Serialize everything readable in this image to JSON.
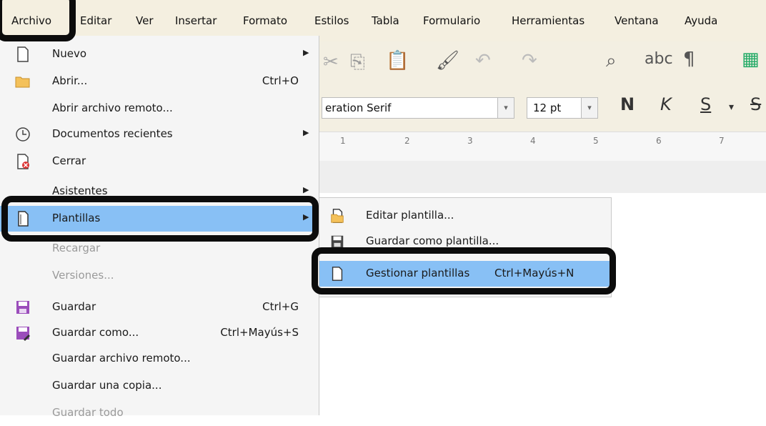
{
  "menubar": {
    "items": [
      {
        "label": "Archivo"
      },
      {
        "label": "Editar"
      },
      {
        "label": "Ver"
      },
      {
        "label": "Insertar"
      },
      {
        "label": "Formato"
      },
      {
        "label": "Estilos"
      },
      {
        "label": "Tabla"
      },
      {
        "label": "Formulario"
      },
      {
        "label": "Herramientas"
      },
      {
        "label": "Ventana"
      },
      {
        "label": "Ayuda"
      }
    ]
  },
  "toolbar": {
    "font_name": "eration Serif",
    "font_size": "12 pt",
    "bold": "N",
    "italic": "K",
    "underline": "S",
    "strike": "S",
    "abc_label": "abc",
    "pilcrow": "¶",
    "ruler_numbers": [
      "1",
      "2",
      "3",
      "4",
      "5",
      "6",
      "7"
    ]
  },
  "file_menu": {
    "items": [
      {
        "label": "Nuevo",
        "icon": "new-document-icon",
        "submenu": true
      },
      {
        "label": "Abrir...",
        "shortcut": "Ctrl+O",
        "icon": "folder-open-icon"
      },
      {
        "label": "Abrir archivo remoto..."
      },
      {
        "label": "Documentos recientes",
        "icon": "clock-icon",
        "submenu": true
      },
      {
        "label": "Cerrar",
        "icon": "close-document-icon"
      },
      {
        "label": "Asistentes",
        "submenu": true
      },
      {
        "label": "Plantillas",
        "icon": "templates-icon",
        "submenu": true,
        "highlighted": true
      },
      {
        "label": "Recargar",
        "disabled": true
      },
      {
        "label": "Versiones...",
        "disabled": true
      },
      {
        "label": "Guardar",
        "shortcut": "Ctrl+G",
        "icon": "save-icon"
      },
      {
        "label": "Guardar como...",
        "shortcut": "Ctrl+Mayús+S",
        "icon": "save-as-icon"
      },
      {
        "label": "Guardar archivo remoto..."
      },
      {
        "label": "Guardar una copia..."
      },
      {
        "label": "Guardar todo",
        "disabled": true
      }
    ]
  },
  "templates_submenu": {
    "items": [
      {
        "label": "Editar plantilla...",
        "icon": "edit-template-icon"
      },
      {
        "label": "Guardar como plantilla...",
        "icon": "save-template-icon"
      },
      {
        "label": "Gestionar plantillas",
        "shortcut": "Ctrl+Mayús+N",
        "icon": "manage-templates-icon",
        "highlighted": true
      }
    ]
  },
  "colors": {
    "highlight": "#88c0f5",
    "annotation_border": "#0c0c0c",
    "menubar_bg": "#f4efe0"
  }
}
